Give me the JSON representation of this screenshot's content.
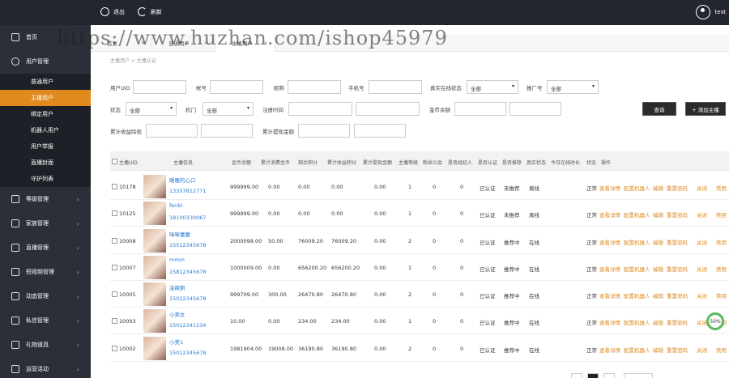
{
  "topbar": {
    "logout": "退出",
    "refresh": "刷新",
    "username": "test"
  },
  "watermark": "https://www.huzhan.com/ishop45979",
  "sidebar": {
    "items": [
      {
        "label": "首页",
        "icon": "home-icon"
      },
      {
        "label": "用户管理",
        "icon": "user-icon"
      }
    ],
    "subitems": [
      {
        "label": "普通用户",
        "active": false
      },
      {
        "label": "主播用户",
        "active": true
      },
      {
        "label": "绑定用户",
        "active": false
      },
      {
        "label": "机器人用户",
        "active": false
      },
      {
        "label": "用户举报",
        "active": false
      },
      {
        "label": "直播封面",
        "active": false
      },
      {
        "label": "守护列表",
        "active": false
      }
    ],
    "groups": [
      {
        "label": "等级管理",
        "icon": "level-icon"
      },
      {
        "label": "家族管理",
        "icon": "family-icon"
      },
      {
        "label": "直播管理",
        "icon": "live-icon"
      },
      {
        "label": "短视频管理",
        "icon": "video-icon"
      },
      {
        "label": "动态管理",
        "icon": "dynamic-icon"
      },
      {
        "label": "私信管理",
        "icon": "message-icon"
      },
      {
        "label": "礼物道具",
        "icon": "gift-icon"
      },
      {
        "label": "运营活动",
        "icon": "activity-icon"
      }
    ]
  },
  "tabs": [
    {
      "label": "首页"
    },
    {
      "label": "普通用户"
    },
    {
      "label": "主播用户"
    }
  ],
  "breadcrumb": "主播用户 > 主播认证",
  "filters": {
    "uid": "用户UID",
    "account": "帐号",
    "nickname": "昵称",
    "phone": "手机号",
    "online_status": "真实在线状态",
    "online_value": "全部",
    "push": "推广号",
    "push_value": "全部",
    "status": "状态",
    "status_value": "全部",
    "gender": "机门",
    "gender_value": "全部",
    "reg_time": "注册时间",
    "coin": "金币余额",
    "cash_in": "累计收益除现",
    "cash_total": "累计提现金额",
    "query_btn": "查询",
    "add_btn": "+ 添加主播"
  },
  "table": {
    "headers": [
      "主播UID",
      "主播信息",
      "金币余额",
      "累计消费金币",
      "剩余积分",
      "累计收益积分",
      "累计提现金额",
      "主播等级",
      "粉丝公会",
      "是否经纪人",
      "是否认证",
      "是否推荐",
      "真实状态",
      "今日在线时长",
      "状态",
      "操作"
    ],
    "rows": [
      {
        "uid": "10178",
        "name": "暖暖的心口",
        "phone": "13357812771",
        "coin": "999999.00",
        "spent": "0.00",
        "left": "0.00",
        "earned": "0.00",
        "cashed": "0.00",
        "level": "1",
        "fans": "0",
        "agent": "0",
        "auth": "已认证",
        "recommend": "未推荐",
        "online": "离线"
      },
      {
        "uid": "10125",
        "name": "fenbi",
        "phone": "18100330067",
        "coin": "999999.00",
        "spent": "0.00",
        "left": "0.00",
        "earned": "0.00",
        "cashed": "0.00",
        "level": "1",
        "fans": "0",
        "agent": "0",
        "auth": "已认证",
        "recommend": "未推荐",
        "online": "离线"
      },
      {
        "uid": "10008",
        "name": "咪咪蕾蕾",
        "phone": "15512345678",
        "coin": "2000098.00",
        "spent": "50.00",
        "left": "76009.20",
        "earned": "76009.20",
        "cashed": "0.00",
        "level": "2",
        "fans": "0",
        "agent": "0",
        "auth": "已认证",
        "recommend": "推荐中",
        "online": "在线"
      },
      {
        "uid": "10007",
        "name": "mmm",
        "phone": "15812345678",
        "coin": "1000009.00",
        "spent": "0.00",
        "left": "656200.20",
        "earned": "656200.20",
        "cashed": "0.00",
        "level": "1",
        "fans": "0",
        "agent": "0",
        "auth": "已认证",
        "recommend": "推荐中",
        "online": "在线"
      },
      {
        "uid": "10005",
        "name": "凌薇丽",
        "phone": "15012345678",
        "coin": "999709.00",
        "spent": "300.00",
        "left": "26470.80",
        "earned": "26470.80",
        "cashed": "0.00",
        "level": "2",
        "fans": "0",
        "agent": "0",
        "auth": "已认证",
        "recommend": "推荐中",
        "online": "在线"
      },
      {
        "uid": "10003",
        "name": "小美女",
        "phone": "15012341234",
        "coin": "10.00",
        "spent": "0.00",
        "left": "234.00",
        "earned": "234.00",
        "cashed": "0.00",
        "level": "1",
        "fans": "0",
        "agent": "0",
        "auth": "已认证",
        "recommend": "推荐中",
        "online": "在线"
      },
      {
        "uid": "10002",
        "name": "小美1",
        "phone": "15012345678",
        "coin": "1981904.00",
        "spent": "19008.00",
        "left": "36190.80",
        "earned": "36190.80",
        "cashed": "0.00",
        "level": "2",
        "fans": "0",
        "agent": "0",
        "auth": "已认证",
        "recommend": "推荐中",
        "online": "在线"
      }
    ],
    "ops": {
      "status": "正常",
      "detail": "查看详情",
      "robot": "配置机器人",
      "edit": "编辑",
      "reset": "重置密码",
      "close": "关闭",
      "ban": "禁用"
    }
  },
  "badge": {
    "percent": "50%",
    "sub": "0.6k/s"
  }
}
